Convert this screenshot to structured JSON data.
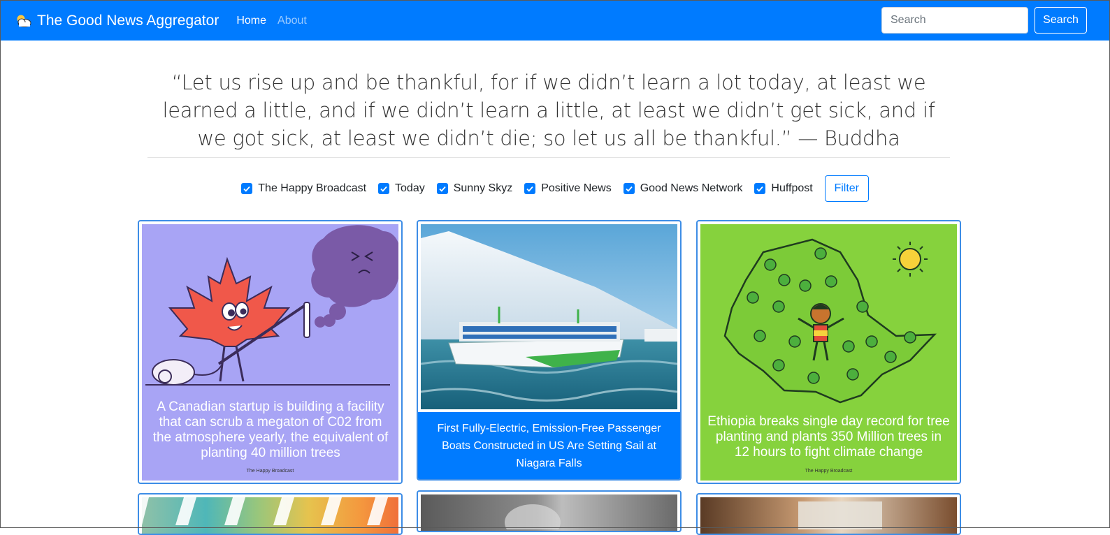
{
  "navbar": {
    "brand": "The Good News Aggregator",
    "brand_icon": "sun-cloud-icon",
    "links": [
      {
        "label": "Home",
        "active": true
      },
      {
        "label": "About",
        "active": false
      }
    ],
    "search_placeholder": "Search",
    "search_button": "Search",
    "color": "#007bff"
  },
  "quote": {
    "text": "“Let us rise up and be thankful, for if we didn’t learn a lot today, at least we learned a little, and if we didn’t learn a little, at least we didn’t get sick, and if we got sick, at least we didn’t die; so let us all be thankful.” — Buddha"
  },
  "filters": {
    "sources": [
      {
        "label": "The Happy Broadcast",
        "checked": true
      },
      {
        "label": "Today",
        "checked": true
      },
      {
        "label": "Sunny Skyz",
        "checked": true
      },
      {
        "label": "Positive News",
        "checked": true
      },
      {
        "label": "Good News Network",
        "checked": true
      },
      {
        "label": "Huffpost",
        "checked": true
      }
    ],
    "button": "Filter"
  },
  "cards": [
    {
      "image_caption": "A Canadian startup is building a facility that can scrub a megaton of C02 from the atmosphere yearly, the equivalent of planting 40 million trees",
      "credit": "The Happy Broadcast",
      "bg": "#a8a4f5"
    },
    {
      "title": "First Fully-Electric, Emission-Free Passenger Boats Constructed in US Are Setting Sail at Niagara Falls"
    },
    {
      "image_caption": "Ethiopia breaks single day record for tree planting and plants 350 Million trees in 12 hours to fight climate change",
      "credit": "The Happy Broadcast",
      "bg": "#86d23d"
    }
  ]
}
